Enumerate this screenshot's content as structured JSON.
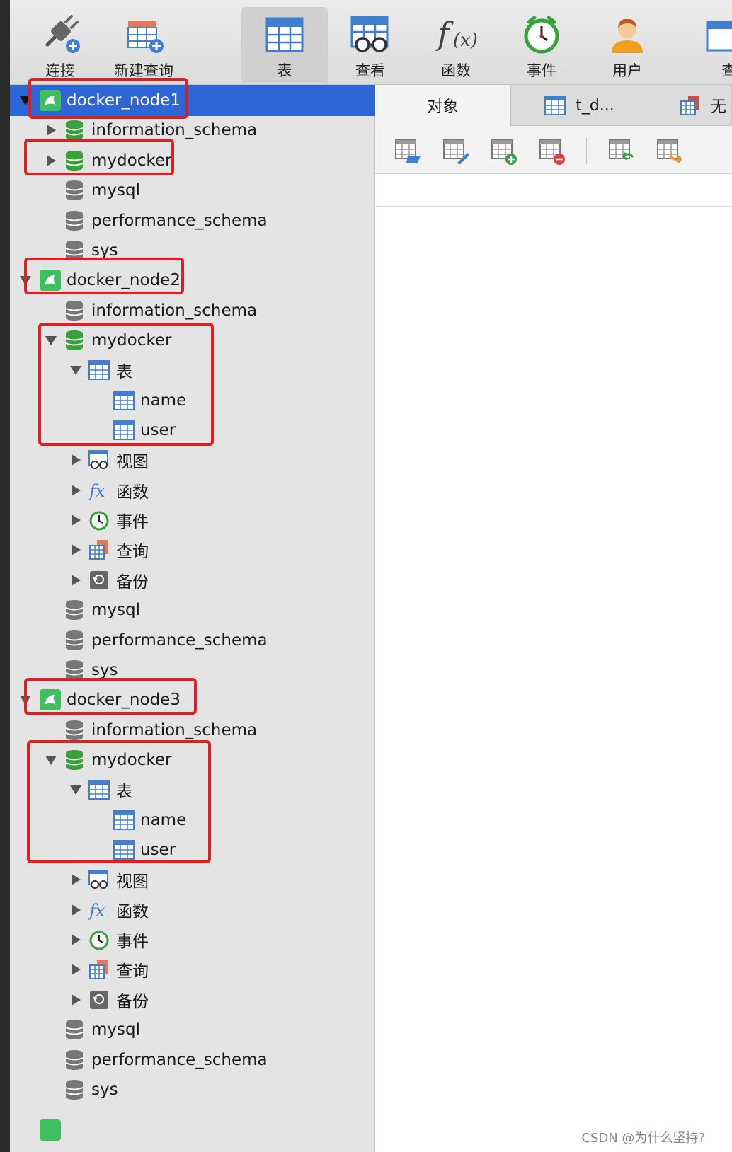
{
  "toolbar": {
    "items": [
      {
        "label": "连接",
        "icon": "plug-add-icon"
      },
      {
        "label": "新建查询",
        "icon": "new-query-icon"
      },
      {
        "label": "表",
        "icon": "table-icon"
      },
      {
        "label": "查看",
        "icon": "view-icon"
      },
      {
        "label": "函数",
        "icon": "function-icon"
      },
      {
        "label": "事件",
        "icon": "clock-icon"
      },
      {
        "label": "用户",
        "icon": "user-icon"
      },
      {
        "label": "查",
        "icon": "query-icon"
      }
    ]
  },
  "tree": {
    "node1": {
      "name": "docker_node1",
      "dbs": [
        "information_schema",
        "mydocker",
        "mysql",
        "performance_schema",
        "sys"
      ]
    },
    "node2": {
      "name": "docker_node2",
      "db0": "information_schema",
      "db1": "mydocker",
      "tables_label": "表",
      "tables": [
        "name",
        "user"
      ],
      "sub": [
        "视图",
        "函数",
        "事件",
        "查询",
        "备份"
      ],
      "rest": [
        "mysql",
        "performance_schema",
        "sys"
      ]
    },
    "node3": {
      "name": "docker_node3",
      "db0": "information_schema",
      "db1": "mydocker",
      "tables_label": "表",
      "tables": [
        "name",
        "user"
      ],
      "sub": [
        "视图",
        "函数",
        "事件",
        "查询",
        "备份"
      ],
      "rest": [
        "mysql",
        "performance_schema",
        "sys"
      ]
    }
  },
  "tabs": [
    "对象",
    "t_d...",
    "无"
  ],
  "colors": {
    "selected": "#2e66d6",
    "highlight_box": "#e02020",
    "db_green": "#3aa03a",
    "table_blue": "#3f7fd0"
  },
  "watermark": "CSDN @为什么坚持?"
}
